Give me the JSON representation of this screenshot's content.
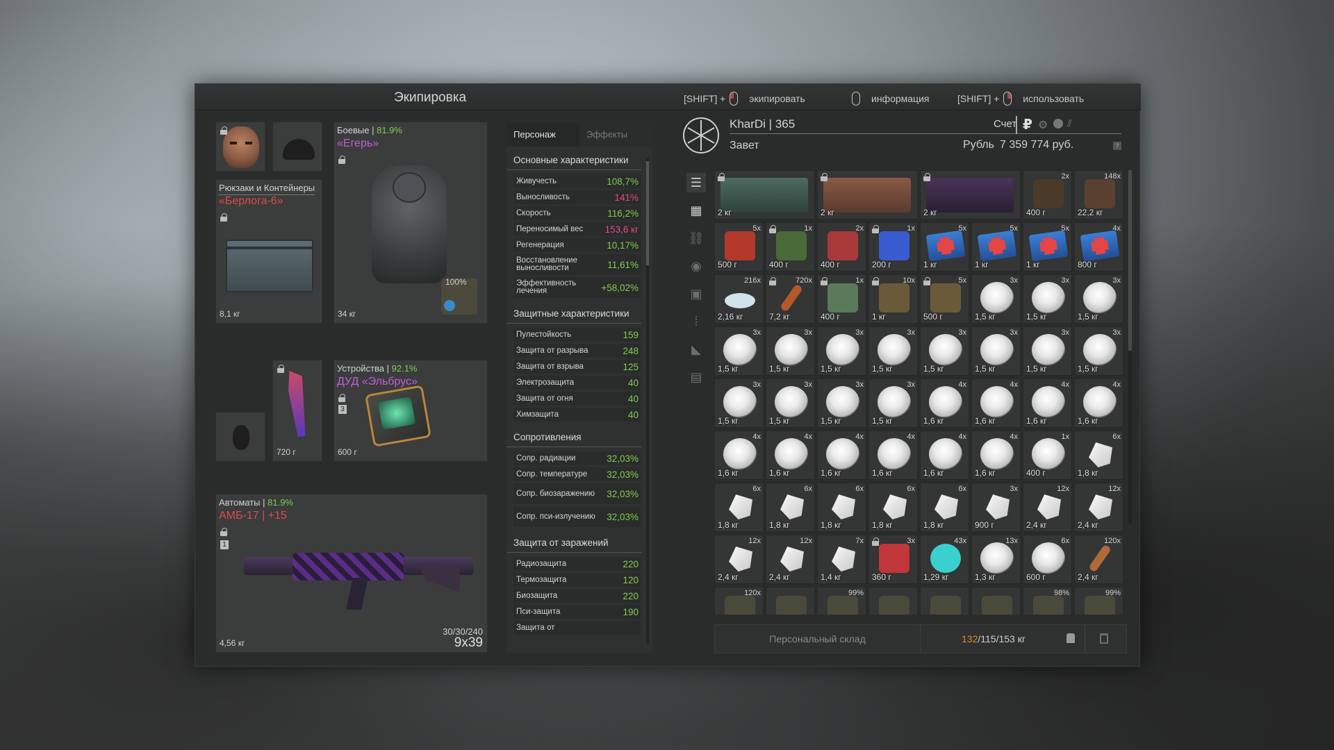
{
  "window": {
    "title": "Экипировка",
    "hints": [
      {
        "prefix": "[SHIFT] +",
        "label": "экипировать"
      },
      {
        "prefix": "",
        "label": "информация"
      },
      {
        "prefix": "[SHIFT] +",
        "label": "использовать"
      }
    ]
  },
  "equipment": {
    "backpack": {
      "label": "Рюкзаки и Контейнеры",
      "name": "«Берлога-6»",
      "weight": "8,1 кг"
    },
    "armor": {
      "label": "Боевые",
      "pct": "81.9%",
      "name": "«Егерь»",
      "weight": "34 кг",
      "badge": "100%"
    },
    "knife": {
      "weight": "720 г"
    },
    "device": {
      "label": "Устройства",
      "pct": "92.1%",
      "name": "ДУД «Эльбрус»",
      "weight": "600 г",
      "slot_num": "3"
    },
    "weapon": {
      "label": "Автоматы",
      "pct": "81.9%",
      "name": "АМБ-17 | +15",
      "weight": "4,56 кг",
      "ammo": "30/30/240",
      "caliber": "9x39",
      "slot_num": "1"
    }
  },
  "stats": {
    "tabs": [
      "Персонаж",
      "Эффекты"
    ],
    "sections": [
      {
        "title": "Основные характеристики",
        "rows": [
          {
            "k": "Живучесть",
            "v": "108,7%"
          },
          {
            "k": "Выносливость",
            "v": "141%",
            "pink": true
          },
          {
            "k": "Скорость",
            "v": "116,2%"
          },
          {
            "k": "Переносимый вес",
            "v": "153,6 кг",
            "pink": true
          },
          {
            "k": "Регенерация",
            "v": "10,17%"
          },
          {
            "k": "Восстановление выносливости",
            "v": "11,61%",
            "tall": true
          },
          {
            "k": "Эффективность лечения",
            "v": "+58,02%",
            "tall": true
          }
        ]
      },
      {
        "title": "Защитные характеристики",
        "rows": [
          {
            "k": "Пулестойкость",
            "v": "159"
          },
          {
            "k": "Защита от разрыва",
            "v": "248"
          },
          {
            "k": "Защита от взрыва",
            "v": "125"
          },
          {
            "k": "Электрозащита",
            "v": "40"
          },
          {
            "k": "Защита от огня",
            "v": "40"
          },
          {
            "k": "Химзащита",
            "v": "40"
          }
        ]
      },
      {
        "title": "Сопротивления",
        "rows": [
          {
            "k": "Сопр. радиации",
            "v": "32,03%"
          },
          {
            "k": "Сопр. температуре",
            "v": "32,03%"
          },
          {
            "k": "Сопр. биозаражению",
            "v": "32,03%",
            "tall": true
          },
          {
            "k": "Сопр. пси-излучению",
            "v": "32,03%",
            "tall": true
          }
        ]
      },
      {
        "title": "Защита от заражений",
        "rows": [
          {
            "k": "Радиозащита",
            "v": "220"
          },
          {
            "k": "Термозащита",
            "v": "120"
          },
          {
            "k": "Биозащита",
            "v": "220"
          },
          {
            "k": "Пси-защита",
            "v": "190"
          },
          {
            "k": "Защита от",
            "v": ""
          }
        ]
      }
    ]
  },
  "account": {
    "player": "KharDi | 365",
    "group": "Завет",
    "balance_label": "Счет",
    "currency_label": "Рубль",
    "balance": "7 359 774 руб."
  },
  "inventory": [
    [
      "box_green|2 кг|",
      "box_red|2 кг|",
      "box_purple|2 кг|",
      "dark|400 г|2x",
      "dark2|22,2 кг|148x"
    ],
    [
      "red_tool|500 г|5x",
      "can|400 г|1x",
      "bottle|400 г|2x",
      "blue|200 г|1x",
      "med|1 кг|5x",
      "med|1 кг|5x",
      "med|1 кг|5x",
      "med|800 г|4x"
    ],
    [
      "dust|2,16 кг|216x",
      "stick|7,2 кг|720x",
      "can2|400 г|1x",
      "log|1 кг|10x",
      "log|500 г|5x",
      "pile|1,5 кг|3x",
      "pile|1,5 кг|3x",
      "pile|1,5 кг|3x"
    ],
    [
      "pile|1,5 кг|3x",
      "pile|1,5 кг|3x",
      "pile|1,5 кг|3x",
      "pile|1,5 кг|3x",
      "pile|1,5 кг|3x",
      "pile|1,5 кг|3x",
      "pile|1,5 кг|3x",
      "pile|1,5 кг|3x"
    ],
    [
      "pile|1,5 кг|3x",
      "pile|1,5 кг|3x",
      "pile|1,5 кг|3x",
      "pile|1,5 кг|3x",
      "pile|1,6 кг|4x",
      "pile|1,6 кг|4x",
      "pile|1,6 кг|4x",
      "pile|1,6 кг|4x"
    ],
    [
      "pile|1,6 кг|4x",
      "pile|1,6 кг|4x",
      "pile|1,6 кг|4x",
      "pile|1,6 кг|4x",
      "pile|1,6 кг|4x",
      "pile|1,6 кг|4x",
      "pile|400 г|1x",
      "shard|1,8 кг|6x"
    ],
    [
      "shard|1,8 кг|6x",
      "shard|1,8 кг|6x",
      "shard|1,8 кг|6x",
      "shard|1,8 кг|6x",
      "shard|1,8 кг|6x",
      "shard|900 г|3x",
      "shard|2,4 кг|12x",
      "shard|2,4 кг|12x"
    ],
    [
      "shard|2,4 кг|12x",
      "shard|2,4 кг|12x",
      "shard|1,4 кг|7x",
      "jar|360 г|3x",
      "orb|1,29 кг|43x",
      "pile|1,3 кг|13x",
      "pile|600 г|6x",
      "stick2|2,4 кг|120x"
    ],
    [
      "misc||120x",
      "misc||",
      "misc||99%",
      "misc||",
      "misc||",
      "misc||",
      "misc||98%",
      "misc||99%"
    ]
  ],
  "storage": {
    "label": "Персональный склад",
    "weight_cur": "132",
    "weight_rest": "/115/153 кг"
  }
}
